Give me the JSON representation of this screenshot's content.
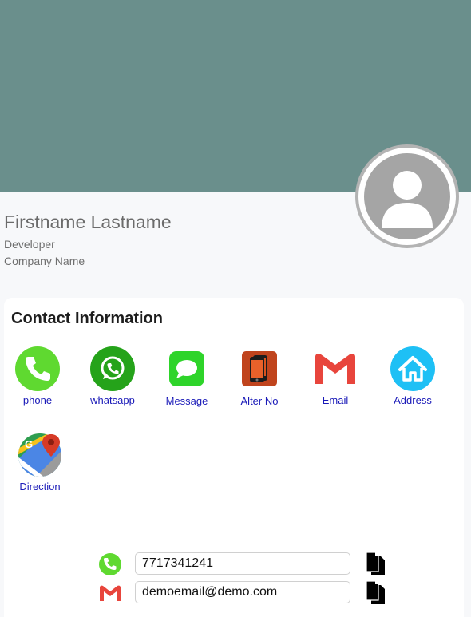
{
  "profile": {
    "name": "Firstname Lastname",
    "role": "Developer",
    "company": "Company Name"
  },
  "contact": {
    "title": "Contact Information",
    "actions": [
      {
        "label": "phone",
        "icon": "phone-icon"
      },
      {
        "label": "whatsapp",
        "icon": "whatsapp-icon"
      },
      {
        "label": "Message",
        "icon": "message-icon"
      },
      {
        "label": "Alter No",
        "icon": "alternate-phone-icon"
      },
      {
        "label": "Email",
        "icon": "gmail-icon"
      },
      {
        "label": "Address",
        "icon": "home-icon"
      },
      {
        "label": "Direction",
        "icon": "google-maps-icon"
      }
    ]
  },
  "details": {
    "phone": "7717341241",
    "email": "demoemail@demo.com"
  },
  "colors": {
    "banner": "#6a8f8c",
    "link": "#1a1ab8",
    "phone_green": "#5fd930",
    "whatsapp_green": "#25a31a",
    "address_blue": "#1ec0f5"
  }
}
